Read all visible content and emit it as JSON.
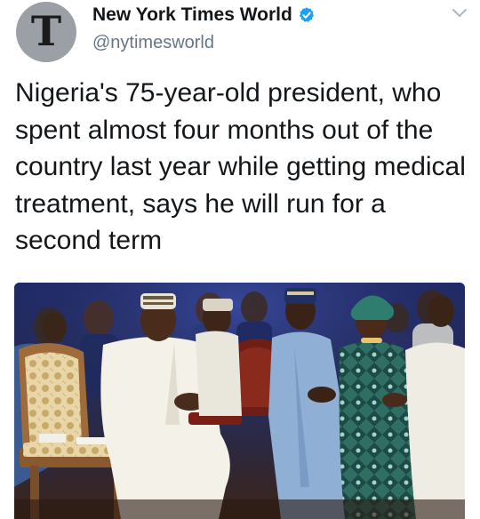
{
  "tweet": {
    "display_name": "New York Times World",
    "handle": "@nytimesworld",
    "avatar_letter": "T",
    "verified": true,
    "text": "Nigeria's 75-year-old president, who spent almost four months out of the country last year while getting medical treatment, says he will run for a second term"
  },
  "icons": {
    "verified": "verified-badge-icon",
    "menu": "chevron-down-icon",
    "avatar": "nyt-logo-avatar"
  },
  "colors": {
    "verified_blue": "#1da1f2",
    "handle_gray": "#657786",
    "text": "#14171a",
    "avatar_bg": "#9aa0a6"
  }
}
